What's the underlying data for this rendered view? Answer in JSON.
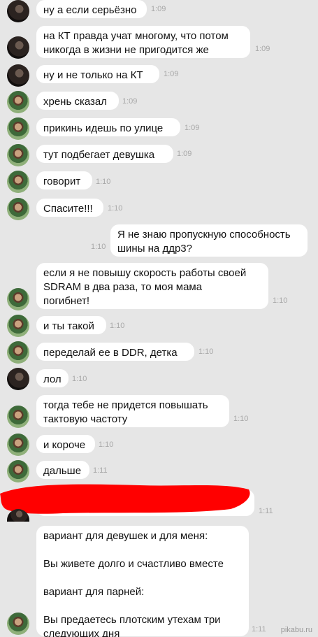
{
  "messages": [
    {
      "text": "ну а если серьёзно",
      "time": "1:09"
    },
    {
      "text": "на КТ правда учат многому, что потом\nникогда в жизни не пригодится же",
      "time": "1:09"
    },
    {
      "text": "ну и не только на КТ",
      "time": "1:09"
    },
    {
      "text": "хрень сказал",
      "time": "1:09"
    },
    {
      "text": "прикинь идешь по улице",
      "time": "1:09"
    },
    {
      "text": "тут подбегает девушка",
      "time": "1:09"
    },
    {
      "text": "говорит",
      "time": "1:10"
    },
    {
      "text": "Спасите!!!",
      "time": "1:10"
    },
    {
      "text": "Я не знаю пропускную способность\nшины на ддр3?",
      "time": "1:10"
    },
    {
      "text": "если я не повышу скорость работы своей\nSDRAM в два раза, то моя мама\nпогибнет!",
      "time": "1:10"
    },
    {
      "text": "и ты такой",
      "time": "1:10"
    },
    {
      "text": "переделай ее в DDR, детка",
      "time": "1:10"
    },
    {
      "text": "лол",
      "time": "1:10"
    },
    {
      "text": "тогда тебе не придется повышать\nтактовую частоту",
      "time": "1:10"
    },
    {
      "text": "и короче",
      "time": "1:10"
    },
    {
      "text": "дальше",
      "time": "1:11"
    },
    {
      "text": "",
      "time": "1:11"
    },
    {
      "text": "вариант для девушек и для меня:\n\nВы живете долго и счастливо вместе\n\nвариант для парней:\n\nВы предаетесь плотским утехам три\nследующих дня",
      "time": "1:11"
    }
  ],
  "watermark": "pikabu.ru",
  "colors": {
    "background": "#e6e6e6",
    "bubble": "#ffffff",
    "time": "#a8a8a8",
    "redacted": "#ff0000"
  }
}
